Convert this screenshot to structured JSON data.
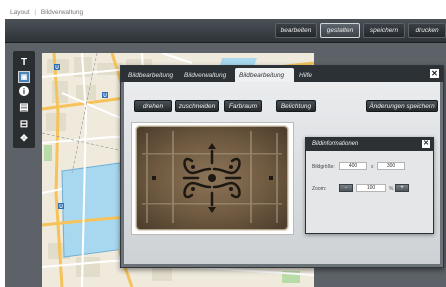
{
  "breadcrumb": {
    "items": [
      "Layout",
      "Bildverwaltung"
    ],
    "separator": "|"
  },
  "toolbar": {
    "buttons": [
      {
        "label": "bearbeiten",
        "active": false
      },
      {
        "label": "gestalten",
        "active": true
      },
      {
        "label": "speichern",
        "active": false
      },
      {
        "label": "drucken",
        "active": false
      }
    ]
  },
  "tools": [
    {
      "icon": "text-tool-icon",
      "glyph": "T"
    },
    {
      "icon": "image-tool-icon",
      "glyph": "▣"
    },
    {
      "icon": "info-tool-icon",
      "glyph": "i"
    },
    {
      "icon": "frame-tool-icon",
      "glyph": "▤"
    },
    {
      "icon": "layout-tool-icon",
      "glyph": "⊟"
    },
    {
      "icon": "move-tool-icon",
      "glyph": "✥"
    }
  ],
  "dialog": {
    "tabs": [
      {
        "label": "Bildbearbeitung",
        "active": false
      },
      {
        "label": "Bildverwaltung",
        "active": false
      },
      {
        "label": "Bildbearbeitung",
        "active": true
      },
      {
        "label": "Hilfe",
        "active": false
      }
    ],
    "close_glyph": "✕",
    "actions": {
      "rotate": "drehen",
      "crop": "zuschneiden",
      "color_space": "Farbraum",
      "exposure": "Belichtung",
      "save_changes": "Änderungen speichern"
    }
  },
  "info_panel": {
    "title": "Bildinformationen",
    "close_glyph": "✕",
    "size_label": "Bildgröße:",
    "width": "400",
    "size_separator": "x",
    "height": "300",
    "zoom_label": "Zoom:",
    "zoom_minus": "-",
    "zoom_value": "100",
    "zoom_unit": "%",
    "zoom_plus": "+"
  },
  "colors": {
    "toolbar_bg": "#2e3337",
    "dialog_tabbar": "#2c3135",
    "workspace": "#5c6267",
    "map_water": "#a8d8f0"
  }
}
